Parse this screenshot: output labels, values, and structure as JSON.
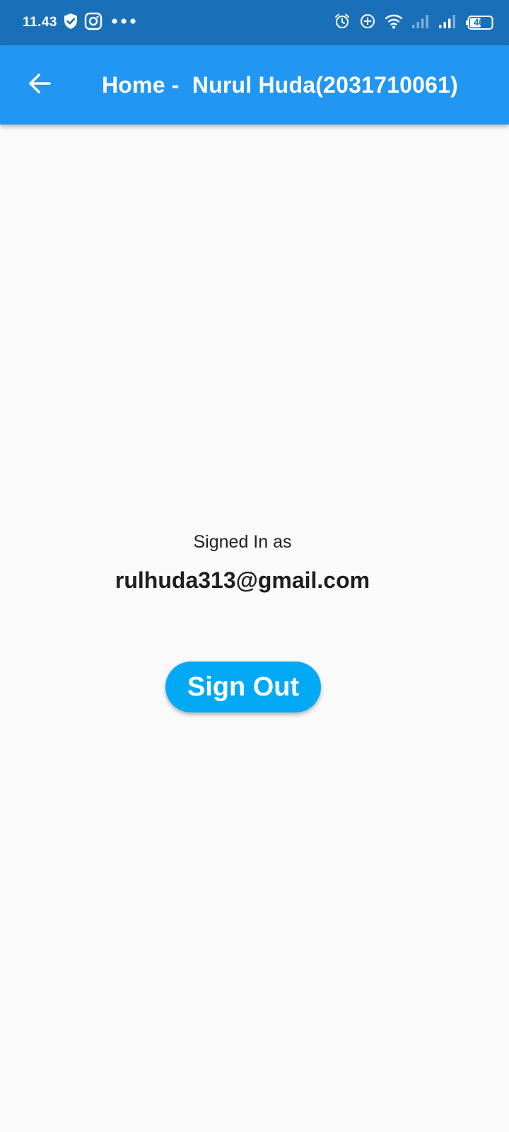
{
  "status_bar": {
    "time": "11.43",
    "battery": "46",
    "background_color": "#1a70b8",
    "icons_left": [
      "shield-check-icon",
      "instagram-icon",
      "more-dots-icon"
    ],
    "icons_right": [
      "alarm-icon",
      "data-saver-icon",
      "wifi-icon",
      "signal-icon-1",
      "signal-icon-2",
      "battery-icon"
    ]
  },
  "app_bar": {
    "title": "Home -  Nurul Huda(2031710061)",
    "background_color": "#2196f3",
    "back_icon": "arrow-back-icon"
  },
  "main": {
    "signed_in_label": "Signed In as",
    "email": "rulhuda313@gmail.com",
    "sign_out_label": "Sign Out",
    "button_color": "#03a9f4"
  }
}
